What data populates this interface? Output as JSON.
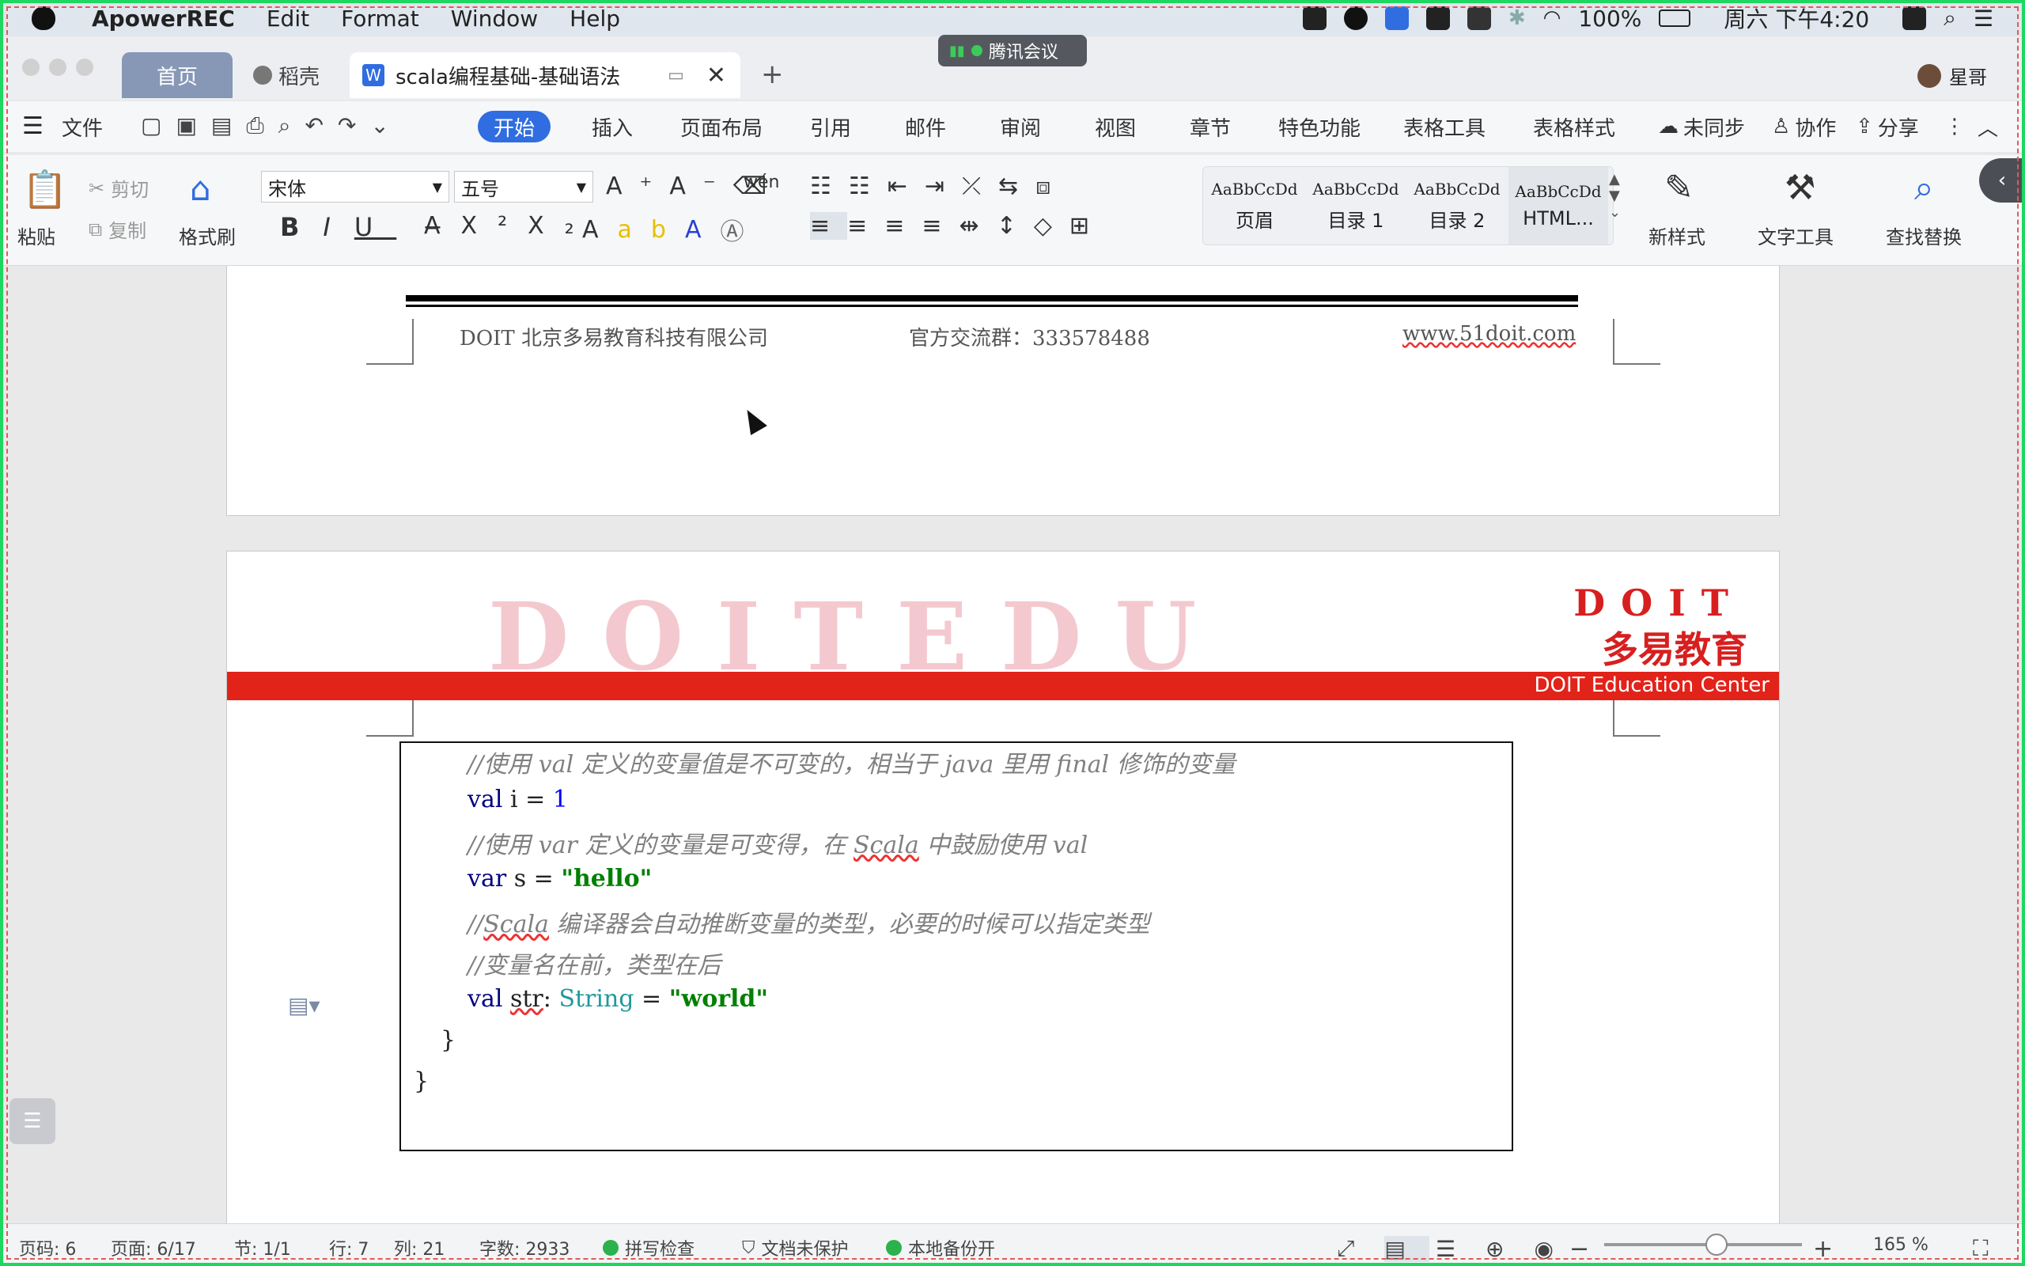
{
  "menubar": {
    "app_name": "ApowerREC",
    "menus": [
      "Edit",
      "Format",
      "Window",
      "Help"
    ],
    "battery": "100%",
    "datetime": "周六 下午4:20"
  },
  "tabs": {
    "home": "首页",
    "daoke": "稻壳",
    "document": "scala编程基础-基础语法",
    "meeting": "腾讯会议",
    "user": "星哥"
  },
  "ribbon": {
    "file": "文件",
    "tabs": [
      "开始",
      "插入",
      "页面布局",
      "引用",
      "邮件",
      "审阅",
      "视图",
      "章节",
      "特色功能",
      "表格工具",
      "表格样式"
    ],
    "sync": "未同步",
    "collab": "协作",
    "share": "分享"
  },
  "toolbar": {
    "paste": "粘贴",
    "cut": "剪切",
    "copy": "复制",
    "format_painter": "格式刷",
    "font_name": "宋体",
    "font_size": "五号",
    "styles": [
      {
        "sample": "AaBbCcDd",
        "name": "页眉"
      },
      {
        "sample": "AaBbCcDd",
        "name": "目录 1"
      },
      {
        "sample": "AaBbCcDd",
        "name": "目录 2"
      },
      {
        "sample": "AaBbCcDd",
        "name": "HTML..."
      }
    ],
    "new_style": "新样式",
    "text_tools": "文字工具",
    "find_replace": "查找替换"
  },
  "document": {
    "footer_company": "DOIT 北京多易教育科技有限公司",
    "footer_group": "官方交流群：333578488",
    "footer_url": "www.51doit.com",
    "watermark": "DOITEDU",
    "brand_en": "DOIT",
    "brand_cn": "多易教育",
    "banner": "DOIT Education Center",
    "code": {
      "c1": "//使用 val 定义的变量值是不可变的，相当于 java 里用 final 修饰的变量",
      "l1_kw": "val",
      "l1_rest": " i = ",
      "l1_num": "1",
      "c2a": "//使用 var 定义的变量是可变得，在 ",
      "c2b": "Scala",
      "c2c": " 中鼓励使用 val",
      "l2_kw": "var",
      "l2_rest": " s = ",
      "l2_str": "\"hello\"",
      "c3a": "//",
      "c3b": "Scala",
      "c3c": " 编译器会自动推断变量的类型，必要的时候可以指定类型",
      "c4": "//变量名在前，类型在后",
      "l3_kw": "val",
      "l3_var": "str",
      "l3_colon": ": ",
      "l3_type": "String",
      "l3_eq": " = ",
      "l3_str": "\"world\"",
      "brace_inner": "}",
      "brace_outer": "}"
    }
  },
  "status": {
    "page_code": "页码: 6",
    "pages": "页面: 6/17",
    "section": "节: 1/1",
    "row": "行: 7",
    "col": "列: 21",
    "words": "字数: 2933",
    "spell": "拼写检查",
    "protect": "文档未保护",
    "backup": "本地备份开",
    "zoom": "165 %"
  }
}
